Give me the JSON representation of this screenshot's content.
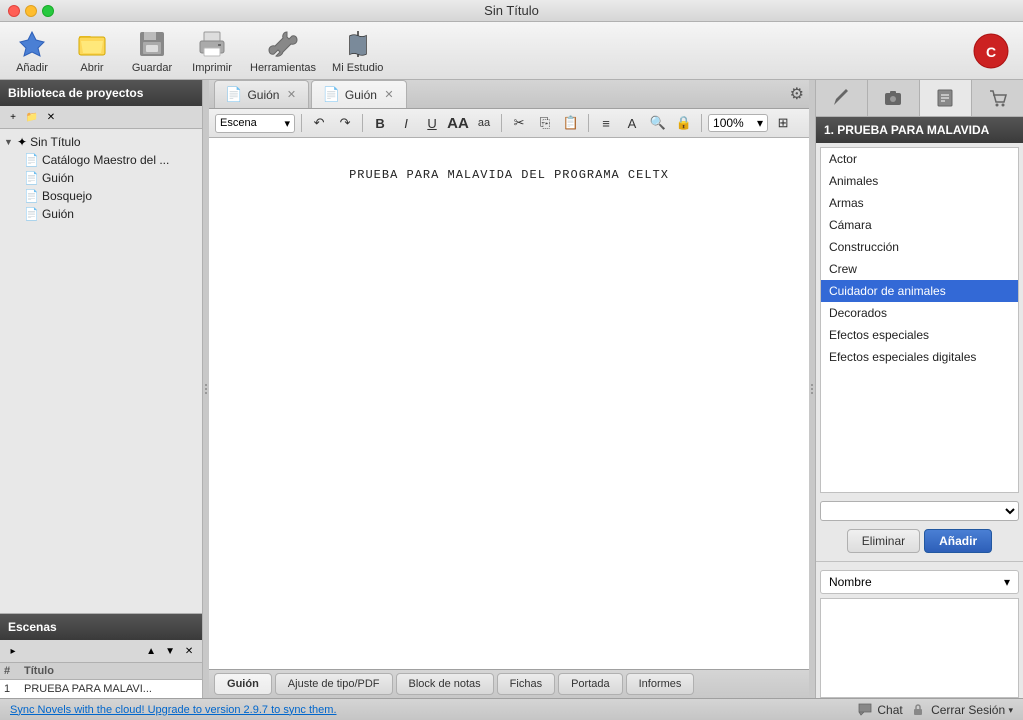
{
  "window": {
    "title": "Sin Título"
  },
  "toolbar": {
    "add_label": "Añadir",
    "open_label": "Abrir",
    "save_label": "Guardar",
    "print_label": "Imprimir",
    "tools_label": "Herramientas",
    "studio_label": "Mi Estudio"
  },
  "sidebar": {
    "header": "Biblioteca de proyectos",
    "tree": {
      "root": "Sin Título",
      "items": [
        {
          "label": "Catálogo Maestro del ...",
          "type": "catalog"
        },
        {
          "label": "Guión",
          "type": "script"
        },
        {
          "label": "Bosquejo",
          "type": "sketch"
        },
        {
          "label": "Guión",
          "type": "script"
        }
      ]
    }
  },
  "scenes": {
    "header": "Escenas",
    "columns": [
      "#",
      "Título"
    ],
    "rows": [
      {
        "num": "1",
        "title": "PRUEBA PARA MALAVI..."
      }
    ]
  },
  "tabs": [
    {
      "label": "Guión",
      "active": false
    },
    {
      "label": "Guión",
      "active": true
    }
  ],
  "format_toolbar": {
    "scene_select": "Escena",
    "zoom": "100%"
  },
  "script": {
    "text": "PRUEBA PARA MALAVIDA DEL PROGRAMA CELTX"
  },
  "bottom_tabs": [
    {
      "label": "Guión",
      "active": true
    },
    {
      "label": "Ajuste de tipo/PDF",
      "active": false
    },
    {
      "label": "Block de notas",
      "active": false
    },
    {
      "label": "Fichas",
      "active": false
    },
    {
      "label": "Portada",
      "active": false
    },
    {
      "label": "Informes",
      "active": false
    }
  ],
  "right_panel": {
    "scene_title": "1. PRUEBA PARA MALAVIDA",
    "categories": [
      "Actor",
      "Animales",
      "Armas",
      "Cámara",
      "Construcción",
      "Crew",
      "Cuidador de animales",
      "Decorados",
      "Efectos especiales",
      "Efectos especiales digitales"
    ],
    "selected_category": "Cuidador de animales",
    "delete_btn": "Eliminar",
    "add_btn": "Añadir",
    "name_header": "Nombre"
  },
  "status_bar": {
    "sync_text": "Sync Novels with the cloud! Upgrade to version 2.9.7 to sync them.",
    "chat_label": "Chat",
    "session_label": "Cerrar Sesión"
  }
}
